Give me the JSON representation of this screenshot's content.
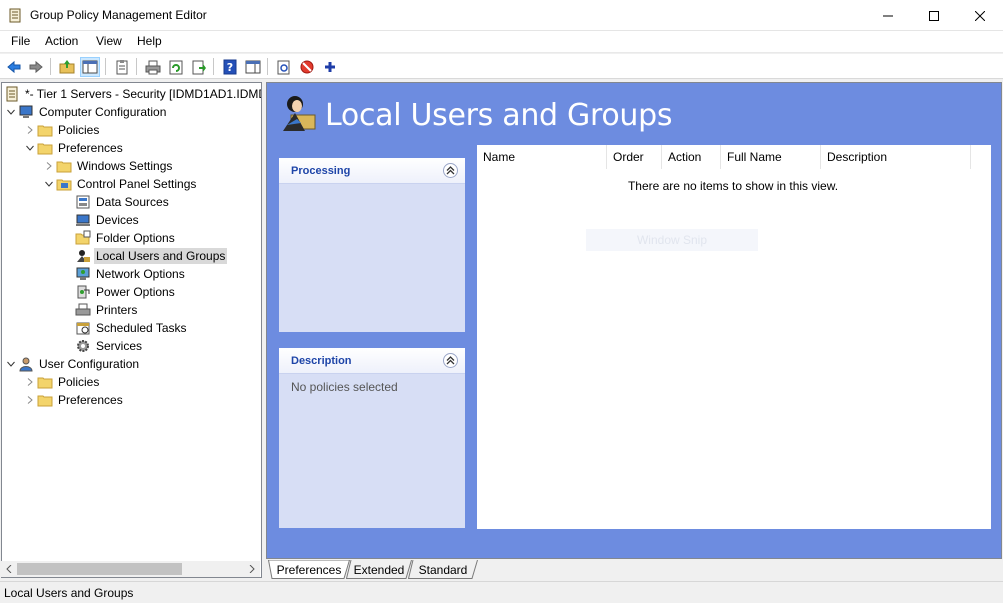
{
  "window": {
    "title": "Group Policy Management Editor"
  },
  "menu": [
    "File",
    "Action",
    "View",
    "Help"
  ],
  "toolbar": {
    "icons": [
      "back-icon",
      "forward-icon",
      "up-folder-icon",
      "show-hide-tree-icon",
      "properties-icon",
      "print-icon",
      "refresh-icon",
      "export-list-icon",
      "help-icon",
      "show-hide-action-pane-icon",
      "run-action-icon",
      "stop-icon",
      "add-icon"
    ]
  },
  "tree": {
    "root": "*- Tier 1 Servers - Security [IDMD1AD1.IDMD",
    "computer_config": "Computer Configuration",
    "policies": "Policies",
    "preferences": "Preferences",
    "windows_settings": "Windows Settings",
    "control_panel_settings": "Control Panel Settings",
    "data_sources": "Data Sources",
    "devices": "Devices",
    "folder_options": "Folder Options",
    "local_users_groups": "Local Users and Groups",
    "network_options": "Network Options",
    "power_options": "Power Options",
    "printers": "Printers",
    "scheduled_tasks": "Scheduled Tasks",
    "services": "Services",
    "user_config": "User Configuration",
    "user_policies": "Policies",
    "user_preferences": "Preferences"
  },
  "content": {
    "title": "Local Users and Groups",
    "processing_label": "Processing",
    "description_label": "Description",
    "description_text": "No policies selected",
    "columns": [
      "Name",
      "Order",
      "Action",
      "Full Name",
      "Description"
    ],
    "empty_message": "There are no items to show in this view.",
    "ghost_text": "Window Snip"
  },
  "tabs": [
    "Preferences",
    "Extended",
    "Standard"
  ],
  "status": "Local Users and Groups",
  "colors": {
    "content_bg": "#6d8ce0",
    "panel_bg": "#d7def5",
    "panel_title": "#1e45a8",
    "selection": "#d9d9d9"
  }
}
